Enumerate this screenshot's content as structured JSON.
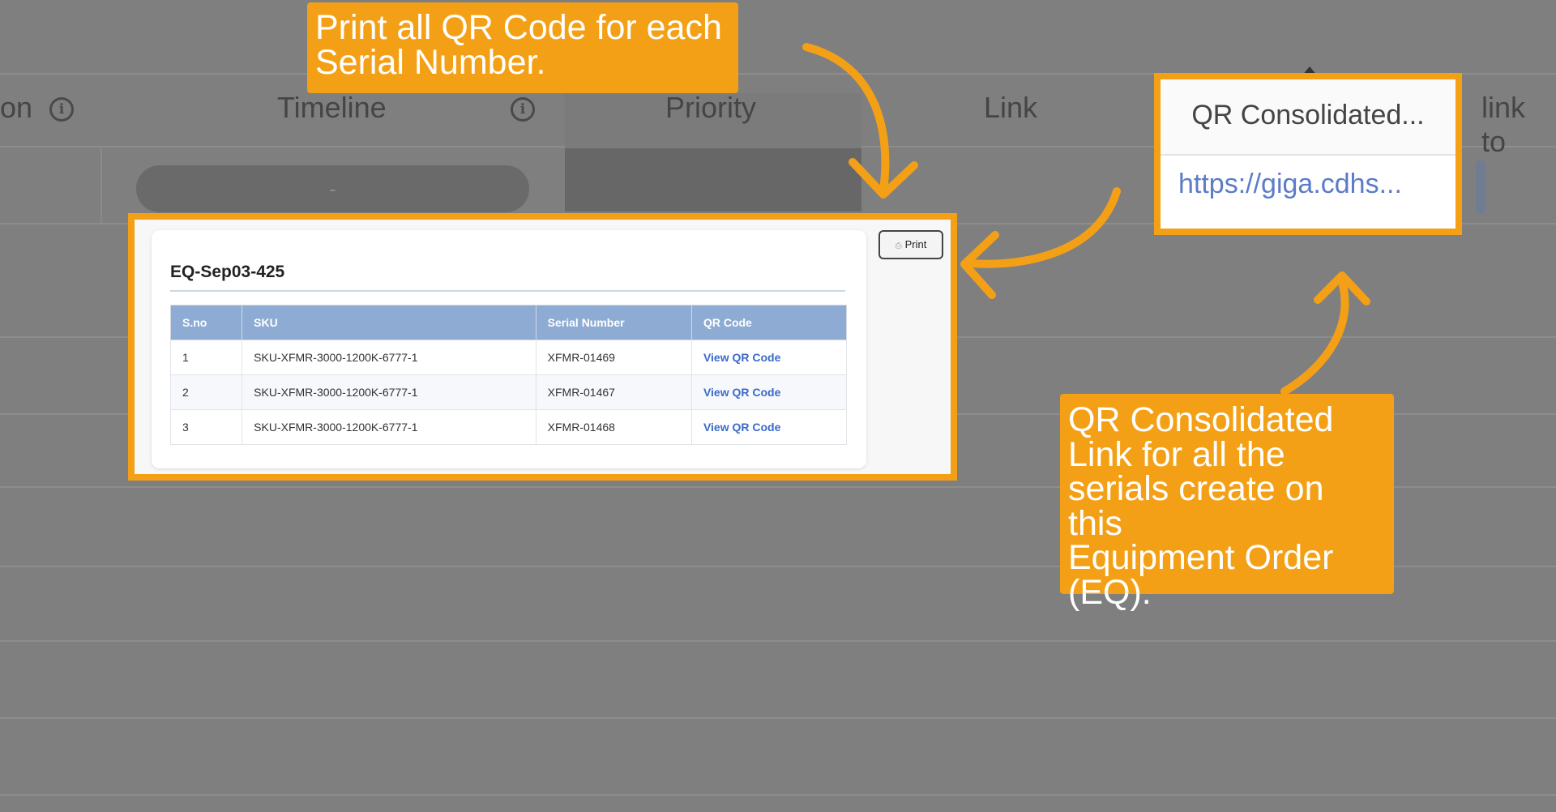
{
  "background_sheet": {
    "headers": {
      "partial_left": "on",
      "timeline": "Timeline",
      "priority": "Priority",
      "link": "Link",
      "partial_right": "link to"
    },
    "timeline_cell": "-"
  },
  "callouts": {
    "top": [
      "Print all QR Code for each",
      "Serial Number."
    ],
    "bottom": [
      "QR Consolidated",
      "Link for all the",
      "serials create on this",
      "Equipment Order",
      "(EQ)."
    ]
  },
  "qr_popup": {
    "title": "EQ-Sep03-425",
    "print_label": "Print",
    "columns": [
      "S.no",
      "SKU",
      "Serial Number",
      "QR Code"
    ],
    "rows": [
      {
        "sno": "1",
        "sku": "SKU-XFMR-3000-1200K-6777-1",
        "serial": "XFMR-01469",
        "qr": "View QR Code"
      },
      {
        "sno": "2",
        "sku": "SKU-XFMR-3000-1200K-6777-1",
        "serial": "XFMR-01467",
        "qr": "View QR Code"
      },
      {
        "sno": "3",
        "sku": "SKU-XFMR-3000-1200K-6777-1",
        "serial": "XFMR-01468",
        "qr": "View QR Code"
      }
    ]
  },
  "qr_consolidated": {
    "header": "QR Consolidated...",
    "link": "https://giga.cdhs..."
  },
  "colors": {
    "accent": "#f4a016",
    "table_header": "#8eacd3",
    "link": "#3b6ac9"
  }
}
